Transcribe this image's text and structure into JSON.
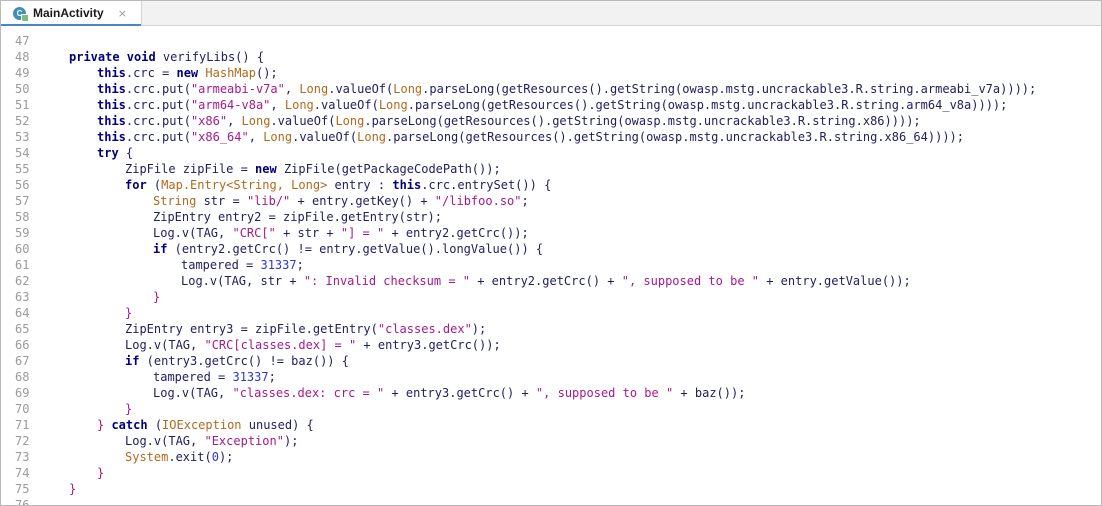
{
  "tab": {
    "icon_letter": "C",
    "title": "MainActivity",
    "close_symbol": "×"
  },
  "lines": [
    {
      "no": "47",
      "indent": 0,
      "tokens": []
    },
    {
      "no": "48",
      "indent": 0,
      "tokens": [
        {
          "t": "private void",
          "c": "kw"
        },
        {
          "t": " verifyLibs() {",
          "c": "plain"
        }
      ]
    },
    {
      "no": "49",
      "indent": 1,
      "tokens": [
        {
          "t": "this",
          "c": "kw"
        },
        {
          "t": ".crc = ",
          "c": "plain"
        },
        {
          "t": "new",
          "c": "kw"
        },
        {
          "t": " ",
          "c": "plain"
        },
        {
          "t": "HashMap",
          "c": "cls"
        },
        {
          "t": "();",
          "c": "plain"
        }
      ]
    },
    {
      "no": "50",
      "indent": 1,
      "tokens": [
        {
          "t": "this",
          "c": "kw"
        },
        {
          "t": ".crc.put(",
          "c": "plain"
        },
        {
          "t": "\"armeabi-v7a\"",
          "c": "str"
        },
        {
          "t": ", ",
          "c": "plain"
        },
        {
          "t": "Long",
          "c": "cls"
        },
        {
          "t": ".valueOf(",
          "c": "plain"
        },
        {
          "t": "Long",
          "c": "cls"
        },
        {
          "t": ".parseLong(getResources().getString(owasp.mstg.uncrackable3.R.string.armeabi_v7a))));",
          "c": "plain"
        }
      ]
    },
    {
      "no": "51",
      "indent": 1,
      "tokens": [
        {
          "t": "this",
          "c": "kw"
        },
        {
          "t": ".crc.put(",
          "c": "plain"
        },
        {
          "t": "\"arm64-v8a\"",
          "c": "str"
        },
        {
          "t": ", ",
          "c": "plain"
        },
        {
          "t": "Long",
          "c": "cls"
        },
        {
          "t": ".valueOf(",
          "c": "plain"
        },
        {
          "t": "Long",
          "c": "cls"
        },
        {
          "t": ".parseLong(getResources().getString(owasp.mstg.uncrackable3.R.string.arm64_v8a))));",
          "c": "plain"
        }
      ]
    },
    {
      "no": "52",
      "indent": 1,
      "tokens": [
        {
          "t": "this",
          "c": "kw"
        },
        {
          "t": ".crc.put(",
          "c": "plain"
        },
        {
          "t": "\"x86\"",
          "c": "str"
        },
        {
          "t": ", ",
          "c": "plain"
        },
        {
          "t": "Long",
          "c": "cls"
        },
        {
          "t": ".valueOf(",
          "c": "plain"
        },
        {
          "t": "Long",
          "c": "cls"
        },
        {
          "t": ".parseLong(getResources().getString(owasp.mstg.uncrackable3.R.string.x86))));",
          "c": "plain"
        }
      ]
    },
    {
      "no": "53",
      "indent": 1,
      "tokens": [
        {
          "t": "this",
          "c": "kw"
        },
        {
          "t": ".crc.put(",
          "c": "plain"
        },
        {
          "t": "\"x86_64\"",
          "c": "str"
        },
        {
          "t": ", ",
          "c": "plain"
        },
        {
          "t": "Long",
          "c": "cls"
        },
        {
          "t": ".valueOf(",
          "c": "plain"
        },
        {
          "t": "Long",
          "c": "cls"
        },
        {
          "t": ".parseLong(getResources().getString(owasp.mstg.uncrackable3.R.string.x86_64))));",
          "c": "plain"
        }
      ]
    },
    {
      "no": "54",
      "indent": 1,
      "tokens": [
        {
          "t": "try",
          "c": "kw"
        },
        {
          "t": " {",
          "c": "plain"
        }
      ]
    },
    {
      "no": "55",
      "indent": 2,
      "tokens": [
        {
          "t": "ZipFile zipFile = ",
          "c": "plain"
        },
        {
          "t": "new",
          "c": "kw"
        },
        {
          "t": " ZipFile(getPackageCodePath());",
          "c": "plain"
        }
      ]
    },
    {
      "no": "56",
      "indent": 2,
      "tokens": [
        {
          "t": "for",
          "c": "kw"
        },
        {
          "t": " (",
          "c": "plain"
        },
        {
          "t": "Map.Entry<String, Long>",
          "c": "cls"
        },
        {
          "t": " entry : ",
          "c": "plain"
        },
        {
          "t": "this",
          "c": "kw"
        },
        {
          "t": ".crc.entrySet()) {",
          "c": "plain"
        }
      ]
    },
    {
      "no": "57",
      "indent": 3,
      "tokens": [
        {
          "t": "String",
          "c": "cls"
        },
        {
          "t": " str = ",
          "c": "plain"
        },
        {
          "t": "\"lib/\"",
          "c": "str"
        },
        {
          "t": " + entry.getKey() + ",
          "c": "plain"
        },
        {
          "t": "\"/libfoo.so\"",
          "c": "str"
        },
        {
          "t": ";",
          "c": "plain"
        }
      ]
    },
    {
      "no": "58",
      "indent": 3,
      "tokens": [
        {
          "t": "ZipEntry entry2 = zipFile.getEntry(str);",
          "c": "plain"
        }
      ]
    },
    {
      "no": "59",
      "indent": 3,
      "tokens": [
        {
          "t": "Log.v(TAG, ",
          "c": "plain"
        },
        {
          "t": "\"CRC[\"",
          "c": "str"
        },
        {
          "t": " + str + ",
          "c": "plain"
        },
        {
          "t": "\"] = \"",
          "c": "str"
        },
        {
          "t": " + entry2.getCrc());",
          "c": "plain"
        }
      ]
    },
    {
      "no": "60",
      "indent": 3,
      "tokens": [
        {
          "t": "if",
          "c": "kw"
        },
        {
          "t": " (entry2.getCrc() != entry.getValue().longValue()) {",
          "c": "plain"
        }
      ]
    },
    {
      "no": "61",
      "indent": 4,
      "tokens": [
        {
          "t": "tampered = ",
          "c": "plain"
        },
        {
          "t": "31337",
          "c": "num"
        },
        {
          "t": ";",
          "c": "plain"
        }
      ]
    },
    {
      "no": "62",
      "indent": 4,
      "tokens": [
        {
          "t": "Log.v(TAG, str + ",
          "c": "plain"
        },
        {
          "t": "\": Invalid checksum = \"",
          "c": "str"
        },
        {
          "t": " + entry2.getCrc() + ",
          "c": "plain"
        },
        {
          "t": "\", supposed to be \"",
          "c": "str"
        },
        {
          "t": " + entry.getValue());",
          "c": "plain"
        }
      ]
    },
    {
      "no": "63",
      "indent": 3,
      "tokens": [
        {
          "t": "}",
          "c": "str"
        }
      ]
    },
    {
      "no": "64",
      "indent": 2,
      "tokens": [
        {
          "t": "}",
          "c": "str"
        }
      ]
    },
    {
      "no": "65",
      "indent": 2,
      "tokens": [
        {
          "t": "ZipEntry entry3 = zipFile.getEntry(",
          "c": "plain"
        },
        {
          "t": "\"classes.dex\"",
          "c": "str"
        },
        {
          "t": ");",
          "c": "plain"
        }
      ]
    },
    {
      "no": "66",
      "indent": 2,
      "tokens": [
        {
          "t": "Log.v(TAG, ",
          "c": "plain"
        },
        {
          "t": "\"CRC[classes.dex] = \"",
          "c": "str"
        },
        {
          "t": " + entry3.getCrc());",
          "c": "plain"
        }
      ]
    },
    {
      "no": "67",
      "indent": 2,
      "tokens": [
        {
          "t": "if",
          "c": "kw"
        },
        {
          "t": " (entry3.getCrc() != baz()) {",
          "c": "plain"
        }
      ]
    },
    {
      "no": "68",
      "indent": 3,
      "tokens": [
        {
          "t": "tampered = ",
          "c": "plain"
        },
        {
          "t": "31337",
          "c": "num"
        },
        {
          "t": ";",
          "c": "plain"
        }
      ]
    },
    {
      "no": "69",
      "indent": 3,
      "tokens": [
        {
          "t": "Log.v(TAG, ",
          "c": "plain"
        },
        {
          "t": "\"classes.dex: crc = \"",
          "c": "str"
        },
        {
          "t": " + entry3.getCrc() + ",
          "c": "plain"
        },
        {
          "t": "\", supposed to be \"",
          "c": "str"
        },
        {
          "t": " + baz());",
          "c": "plain"
        }
      ]
    },
    {
      "no": "70",
      "indent": 2,
      "tokens": [
        {
          "t": "}",
          "c": "str"
        }
      ]
    },
    {
      "no": "71",
      "indent": 1,
      "tokens": [
        {
          "t": "}",
          "c": "str"
        },
        {
          "t": " catch",
          "c": "kw"
        },
        {
          "t": " (",
          "c": "plain"
        },
        {
          "t": "IOException",
          "c": "cls"
        },
        {
          "t": " unused) {",
          "c": "plain"
        }
      ]
    },
    {
      "no": "72",
      "indent": 2,
      "tokens": [
        {
          "t": "Log.v(TAG, ",
          "c": "plain"
        },
        {
          "t": "\"Exception\"",
          "c": "str"
        },
        {
          "t": ");",
          "c": "plain"
        }
      ]
    },
    {
      "no": "73",
      "indent": 2,
      "tokens": [
        {
          "t": "System",
          "c": "cls"
        },
        {
          "t": ".exit(",
          "c": "plain"
        },
        {
          "t": "0",
          "c": "num"
        },
        {
          "t": ");",
          "c": "plain"
        }
      ]
    },
    {
      "no": "74",
      "indent": 1,
      "tokens": [
        {
          "t": "}",
          "c": "str"
        }
      ]
    },
    {
      "no": "75",
      "indent": 0,
      "tokens": [
        {
          "t": "}",
          "c": "str"
        }
      ]
    },
    {
      "no": "76",
      "indent": 0,
      "tokens": []
    }
  ]
}
